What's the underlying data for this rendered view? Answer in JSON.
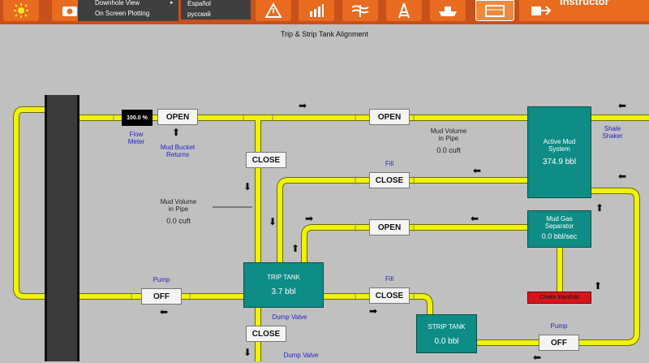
{
  "toolbar": {
    "buttons": [
      "sun-icon",
      "camera-icon",
      "rig-warning-icon",
      "bar-chart-icon",
      "formation-icon",
      "derrick-icon",
      "ship-icon",
      "tank-icon"
    ],
    "menu_items": [
      "Downhole View",
      "On Screen Plotting"
    ],
    "languages": [
      "Español",
      "русский"
    ],
    "instructor_label": "Instructor"
  },
  "page_title": "Trip & Strip Tank Alignment",
  "flow_meter": {
    "value": "100.0 %",
    "label": "Flow\nMeter"
  },
  "mud_bucket_label": "Mud Bucket\nReturns",
  "valves": {
    "top_open_1": "OPEN",
    "top_open_2": "OPEN",
    "close_mid": "CLOSE",
    "fill_close": "CLOSE",
    "gas_open": "OPEN",
    "pump_off_left": "OFF",
    "trip_fill_close": "CLOSE",
    "dump_close": "CLOSE",
    "pump_off_right": "OFF"
  },
  "labels": {
    "fill_top": "Fill",
    "fill_trip": "Fill",
    "pump_left": "Pump",
    "pump_right": "Pump",
    "dump_valve_1": "Dump Valve",
    "dump_valve_2": "Dump Valve",
    "shale_shaker": "Shale\nShaker",
    "mud_vol_1_title": "Mud Volume\nin Pipe",
    "mud_vol_1_value": "0.0 cuft",
    "mud_vol_2_title": "Mud Volume\nin Pipe",
    "mud_vol_2_value": "0.0 cuft"
  },
  "tanks": {
    "active": {
      "title": "Active Mud\nSystem",
      "value": "374.9 bbl"
    },
    "gas_sep": {
      "title": "Mud Gas\nSeparator",
      "value": "0.0 bbl/sec"
    },
    "trip": {
      "title": "TRIP TANK",
      "value": "3.7 bbl"
    },
    "strip": {
      "title": "STRIP TANK",
      "value": "0.0 bbl"
    }
  },
  "choke_manifold_label": "Choke Manifold",
  "colors": {
    "pipe": "#f0f20a",
    "tank": "#0e8c86",
    "toolbar": "#e96b1f",
    "choke": "#d8141b"
  }
}
